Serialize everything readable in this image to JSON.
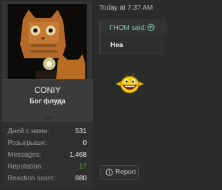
{
  "post": {
    "timestamp": "Today at 7:37 AM",
    "quote": {
      "author_label": "ГНОМ said:",
      "body": "Hea"
    },
    "report_label": "Report"
  },
  "user": {
    "username": "CONIY",
    "title": "Бог флуда",
    "stats": [
      {
        "label": "Дней с нами:",
        "value": "531"
      },
      {
        "label": "Розыгрыши:",
        "value": "0"
      },
      {
        "label": "Messages:",
        "value": "1,468"
      },
      {
        "label": "Reputation :",
        "value": "17"
      },
      {
        "label": "Reaction score:",
        "value": "880"
      }
    ]
  },
  "colors": {
    "accent": "#7fc6b0",
    "reputation": "#6aa84f",
    "background": "#2b2b2b"
  },
  "icons": {
    "quote_jump": "arrow-up-circle-icon",
    "report": "info-circle-icon",
    "emoticon": "big-grin-smiley-icon"
  }
}
